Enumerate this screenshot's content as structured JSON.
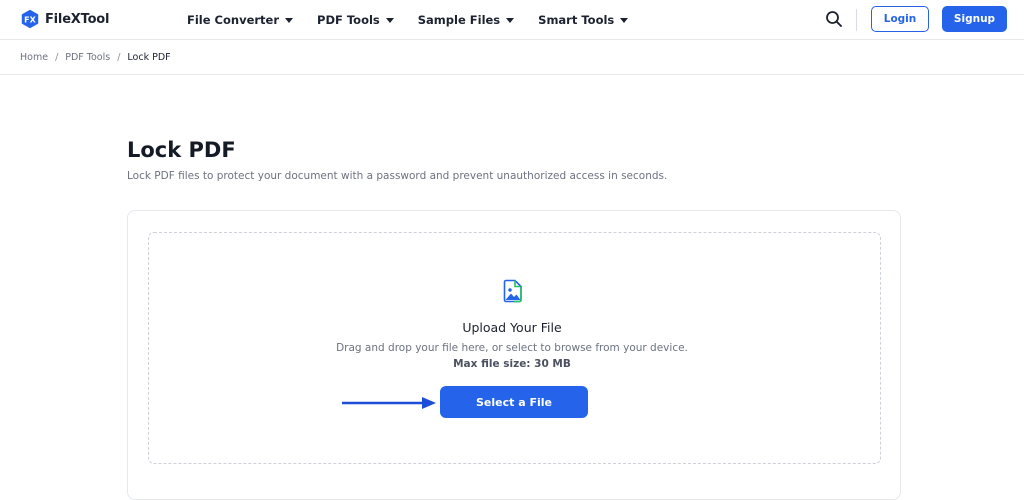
{
  "brand": {
    "logo_badge": "FX",
    "name": "FileXTool",
    "accent_color": "#2563eb"
  },
  "nav": [
    {
      "label": "File Converter"
    },
    {
      "label": "PDF Tools"
    },
    {
      "label": "Sample Files"
    },
    {
      "label": "Smart Tools"
    }
  ],
  "header_actions": {
    "login": "Login",
    "signup": "Signup",
    "search_icon": "search-icon"
  },
  "breadcrumb": {
    "home": "Home",
    "section": "PDF Tools",
    "current": "Lock PDF",
    "separator": "/"
  },
  "page": {
    "title": "Lock PDF",
    "description": "Lock PDF files to protect your document with a password and prevent unauthorized access in seconds."
  },
  "upload": {
    "icon": "image-file-icon",
    "title": "Upload Your File",
    "subtitle": "Drag and drop your file here, or select to browse from your device.",
    "max_size": "Max file size: 30 MB",
    "button": "Select a File",
    "pointer": "arrow-right-icon"
  }
}
